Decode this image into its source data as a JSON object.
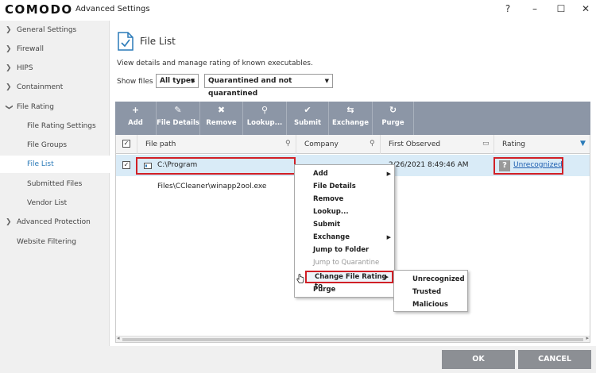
{
  "app": {
    "logo": "COMODO",
    "title": "Advanced Settings",
    "help": "?",
    "minimize": "–",
    "maximize": "☐",
    "close": "✕"
  },
  "sidebar": {
    "items": [
      {
        "label": "General Settings",
        "chevron": "❯"
      },
      {
        "label": "Firewall",
        "chevron": "❯"
      },
      {
        "label": "HIPS",
        "chevron": "❯"
      },
      {
        "label": "Containment",
        "chevron": "❯"
      },
      {
        "label": "File Rating",
        "chevron": "❯"
      },
      {
        "label": "File Rating Settings"
      },
      {
        "label": "File Groups"
      },
      {
        "label": "File List"
      },
      {
        "label": "Submitted Files"
      },
      {
        "label": "Vendor List"
      },
      {
        "label": "Advanced Protection",
        "chevron": "❯"
      },
      {
        "label": "Website Filtering"
      }
    ]
  },
  "main": {
    "title": "File List",
    "description": "View details and manage rating of known executables.",
    "show_files_label": "Show files",
    "filter_type": "All types",
    "filter_status": "Quarantined and not quarantined"
  },
  "toolbar": {
    "buttons": [
      {
        "label": "Add",
        "icon": "+"
      },
      {
        "label": "File Details",
        "icon": "✎"
      },
      {
        "label": "Remove",
        "icon": "✖"
      },
      {
        "label": "Lookup...",
        "icon": "⚲"
      },
      {
        "label": "Submit",
        "icon": "✔"
      },
      {
        "label": "Exchange",
        "icon": "⇆"
      },
      {
        "label": "Purge",
        "icon": "↻"
      }
    ]
  },
  "table": {
    "columns": [
      "File path",
      "Company",
      "First Observed",
      "Rating"
    ],
    "rows": [
      {
        "file_path": "C:\\Program Files\\CCleaner\\winapp2ool.exe",
        "company": "",
        "first_observed": "2/26/2021 8:49:46 AM",
        "rating": "Unrecognized"
      }
    ]
  },
  "context_menu": {
    "items": [
      "Add",
      "File Details",
      "Remove",
      "Lookup...",
      "Submit",
      "Exchange",
      "Jump to Folder",
      "Jump to Quarantine",
      "Change File Rating to",
      "Purge"
    ],
    "submenu_arrow": "▶"
  },
  "submenu": {
    "items": [
      "Unrecognized",
      "Trusted",
      "Malicious"
    ]
  },
  "footer": {
    "ok": "OK",
    "cancel": "CANCEL"
  },
  "colors": {
    "toolbar": "#8c96a6",
    "highlight": "#d12027",
    "selected_row": "#d9ebf7",
    "accent": "#2a7ab8"
  }
}
